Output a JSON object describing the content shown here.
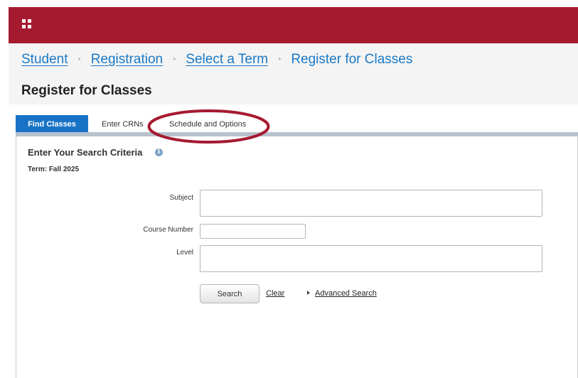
{
  "colors": {
    "brand_bar": "#a61a30",
    "link_blue": "#1a79c6",
    "active_tab": "#1873c6",
    "highlight_ring": "#a61a30"
  },
  "header": {
    "apps_icon": "apps-grid-icon"
  },
  "breadcrumb": {
    "items": [
      {
        "label": "Student"
      },
      {
        "label": "Registration"
      },
      {
        "label": "Select a Term"
      },
      {
        "label": "Register for Classes"
      }
    ],
    "separator": "•"
  },
  "page": {
    "title": "Register for Classes"
  },
  "tabs": [
    {
      "label": "Find Classes",
      "active": true
    },
    {
      "label": "Enter CRNs",
      "active": false
    },
    {
      "label": "Schedule and Options",
      "active": false,
      "highlighted": true
    }
  ],
  "search": {
    "heading": "Enter Your Search Criteria",
    "info_icon": "info-icon",
    "term": "Term: Fall 2025",
    "fields": {
      "subject": {
        "label": "Subject",
        "value": ""
      },
      "course_number": {
        "label": "Course Number",
        "value": ""
      },
      "level": {
        "label": "Level",
        "value": ""
      }
    },
    "search_label": "Search",
    "clear_label": "Clear",
    "advanced_label": "Advanced Search"
  }
}
